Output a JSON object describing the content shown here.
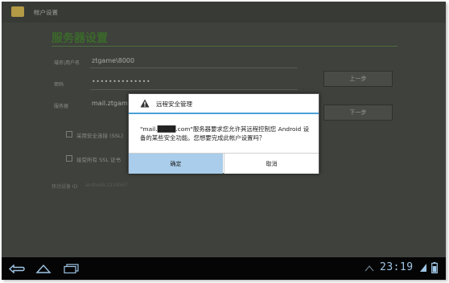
{
  "app": {
    "title": "帐户设置"
  },
  "page": {
    "heading": "服务器设置"
  },
  "form": {
    "domain_user_label": "域名\\用户名",
    "domain_user_value": "ztgame\\8000",
    "password_label": "密码",
    "password_value": "••••••••••••••",
    "server_label": "服务器",
    "server_value": "mail.ztgame.c",
    "ssl_label": "采用安全连接 (SSL)",
    "accept_ssl_label": "接受所有 SSL 证书",
    "device_id_label": "移动设备 ID",
    "device_id_value": "androidc1234567"
  },
  "buttons": {
    "prev": "上一步",
    "next": "下一步"
  },
  "dialog": {
    "title": "远程安全管理",
    "message": "\"mail.████.com\"服务器要求您允许其远程控制您 Android 设备的某些安全功能。您想要完成此帐户设置吗？",
    "ok": "确定",
    "cancel": "取消"
  },
  "status": {
    "clock": "23:19"
  },
  "colors": {
    "accent": "#4aa0d8",
    "heading": "#3b6a2a",
    "ok_button": "#a9cdea",
    "clock": "#9fc6e6"
  },
  "icons": [
    "app-icon",
    "warning-icon",
    "back-icon",
    "home-icon",
    "recent-apps-icon",
    "status-icon"
  ]
}
